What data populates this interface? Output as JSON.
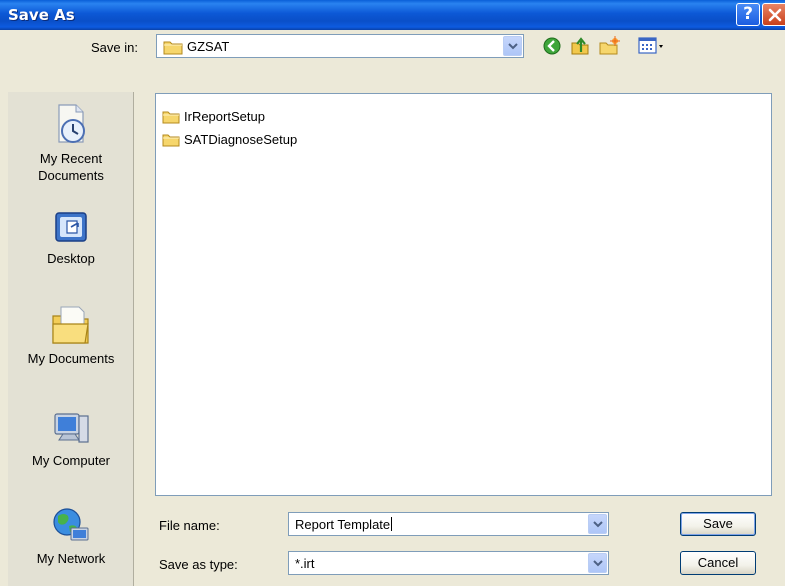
{
  "window": {
    "title": "Save As",
    "help_glyph": "?",
    "colors": {
      "titlebar": "#0a4fc8",
      "face": "#ece9d8",
      "close": "#c9401a"
    }
  },
  "save_in": {
    "label": "Save in:",
    "value": "GZSAT",
    "icon": "folder-icon"
  },
  "toolbar": [
    {
      "name": "back-icon",
      "tooltip": "Back"
    },
    {
      "name": "up-folder-icon",
      "tooltip": "Up One Level"
    },
    {
      "name": "new-folder-icon",
      "tooltip": "Create New Folder"
    },
    {
      "name": "view-menu-icon",
      "tooltip": "View Menu"
    }
  ],
  "places": [
    {
      "id": "recent",
      "label_1": "My Recent",
      "label_2": "Documents",
      "icon": "recent-documents-icon"
    },
    {
      "id": "desktop",
      "label_1": "Desktop",
      "label_2": "",
      "icon": "desktop-icon"
    },
    {
      "id": "documents",
      "label_1": "My Documents",
      "label_2": "",
      "icon": "my-documents-icon"
    },
    {
      "id": "computer",
      "label_1": "My Computer",
      "label_2": "",
      "icon": "my-computer-icon"
    },
    {
      "id": "network",
      "label_1": "My Network",
      "label_2": "",
      "icon": "my-network-icon"
    }
  ],
  "files": [
    {
      "name": "IrReportSetup",
      "type": "folder"
    },
    {
      "name": "SATDiagnoseSetup",
      "type": "folder"
    }
  ],
  "file_name": {
    "label": "File name:",
    "value": "Report Template"
  },
  "save_as_type": {
    "label": "Save as type:",
    "value": "*.irt"
  },
  "buttons": {
    "save": "Save",
    "cancel": "Cancel"
  }
}
